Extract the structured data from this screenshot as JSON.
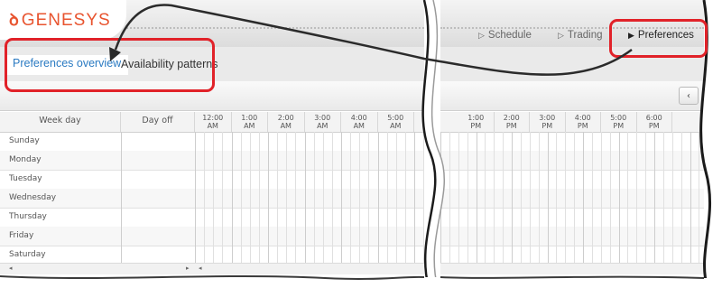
{
  "brand": {
    "name": "GENESYS",
    "color": "#e8542f"
  },
  "nav": {
    "schedule_label": "Schedule",
    "trading_label": "Trading",
    "preferences_label": "Preferences"
  },
  "subtabs": {
    "overview_label": "Preferences overview",
    "patterns_label": "Availability patterns"
  },
  "toolbar": {
    "collapse_glyph": "‹"
  },
  "grid": {
    "weekday_header": "Week day",
    "dayoff_header": "Day off",
    "left_times": [
      {
        "t": "12:00",
        "p": "AM"
      },
      {
        "t": "1:00",
        "p": "AM"
      },
      {
        "t": "2:00",
        "p": "AM"
      },
      {
        "t": "3:00",
        "p": "AM"
      },
      {
        "t": "4:00",
        "p": "AM"
      },
      {
        "t": "5:00",
        "p": "AM"
      }
    ],
    "right_times": [
      {
        "t": "1:00",
        "p": "PM"
      },
      {
        "t": "2:00",
        "p": "PM"
      },
      {
        "t": "3:00",
        "p": "PM"
      },
      {
        "t": "4:00",
        "p": "PM"
      },
      {
        "t": "5:00",
        "p": "PM"
      },
      {
        "t": "6:00",
        "p": "PM"
      }
    ],
    "days": [
      "Sunday",
      "Monday",
      "Tuesday",
      "Wednesday",
      "Thursday",
      "Friday",
      "Saturday"
    ]
  },
  "scroll": {
    "left_arrow": "◂",
    "right_arrow": "▸"
  },
  "colors": {
    "accent": "#2a7ac2",
    "callout": "#e12229"
  }
}
